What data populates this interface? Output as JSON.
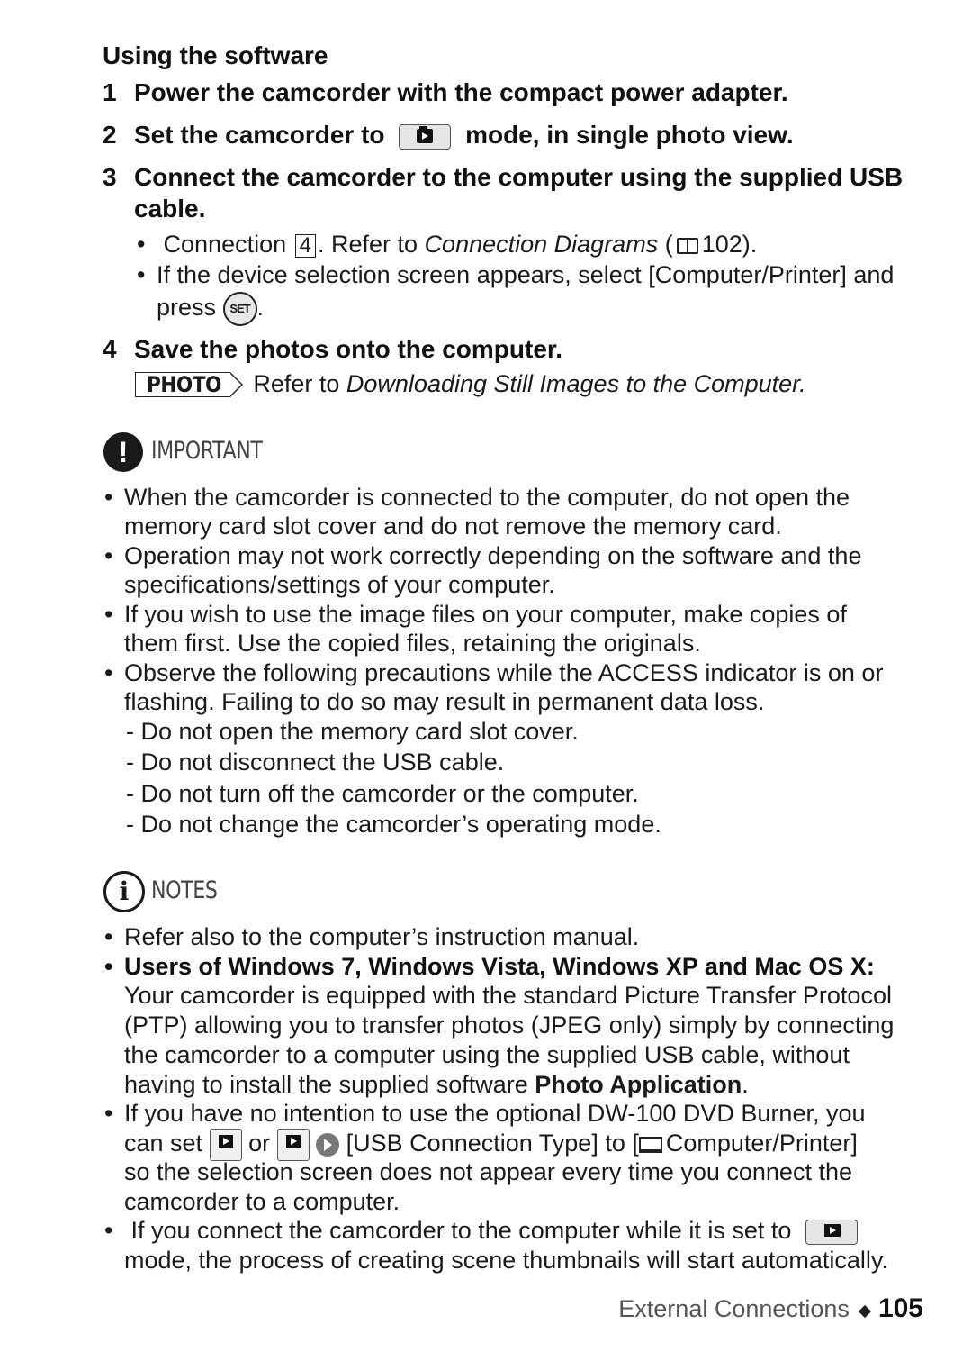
{
  "section_title": "Using the software",
  "steps": [
    {
      "num": "1",
      "text": "Power the camcorder with the compact power adapter."
    },
    {
      "num": "2",
      "text_before": "Set the camcorder to",
      "icon": "photo-mode-icon",
      "text_after": "mode, in single photo view."
    },
    {
      "num": "3",
      "line1": "Connect the camcorder to the computer using the supplied USB",
      "line2": "cable."
    },
    {
      "num": "4",
      "text": "Save the photos onto the computer."
    }
  ],
  "step3_bullets": {
    "b1_prefix": "Connection",
    "b1_box": "4",
    "b1_mid": ". Refer to",
    "b1_italic": "Connection Diagrams",
    "b1_paren_open": "(",
    "b1_page": "102).",
    "b2_line1": "If the device selection screen appears, select [Computer/Printer] and",
    "b2_line2": "press",
    "b2_set": "SET",
    "b2_end": "."
  },
  "step4_ref": {
    "tag": "PHOTO",
    "text": "Refer to",
    "italic": "Downloading Still Images to the Computer."
  },
  "important": {
    "heading": "IMPORTANT",
    "icon_glyph": "!",
    "items": [
      [
        "When the camcorder is connected to the computer, do not open the",
        "memory card slot cover and do not remove the memory card."
      ],
      [
        "Operation may not work correctly depending on the software and the",
        "specifications/settings of your computer."
      ],
      [
        "If you wish to use the image files on your computer, make copies of",
        "them first. Use the copied files, retaining the originals."
      ],
      [
        "Observe the following precautions while the ACCESS indicator is on or",
        "flashing. Failing to do so may result in permanent data loss."
      ]
    ],
    "dash_items": [
      "- Do not open the memory card slot cover.",
      "- Do not disconnect the USB cable.",
      "- Do not turn off the camcorder or the computer.",
      "- Do not change the camcorder’s operating mode."
    ]
  },
  "notes": {
    "heading": "NOTES",
    "icon_glyph": "i",
    "n1": "Refer also to the computer’s instruction manual.",
    "n2_bold": "Users of Windows 7, Windows Vista, Windows XP and Mac OS X:",
    "n2_lines": [
      "Your camcorder is equipped with the standard Picture Transfer Protocol",
      "(PTP) allowing you to transfer photos (JPEG only) simply by connecting",
      "the camcorder to a computer using the supplied USB cable, without"
    ],
    "n2_last_prefix": "having to install the supplied software",
    "n2_last_bold": "Photo Application",
    "n2_last_end": ".",
    "n3_line1": "If you have no intention to use the optional DW-100 DVD Burner, you",
    "n3_can_set": "can set",
    "n3_or": "or",
    "n3_setting": "[USB Connection Type] to [",
    "n3_value": "Computer/Printer]",
    "n3_line3": "so the selection screen does not appear every time you connect the",
    "n3_line4": "camcorder to a computer.",
    "n4_line1": "If you connect the camcorder to the computer while it is set to",
    "n4_line2": "mode, the process of creating scene thumbnails will start automatically."
  },
  "footer": {
    "section": "External Connections",
    "page": "105"
  }
}
